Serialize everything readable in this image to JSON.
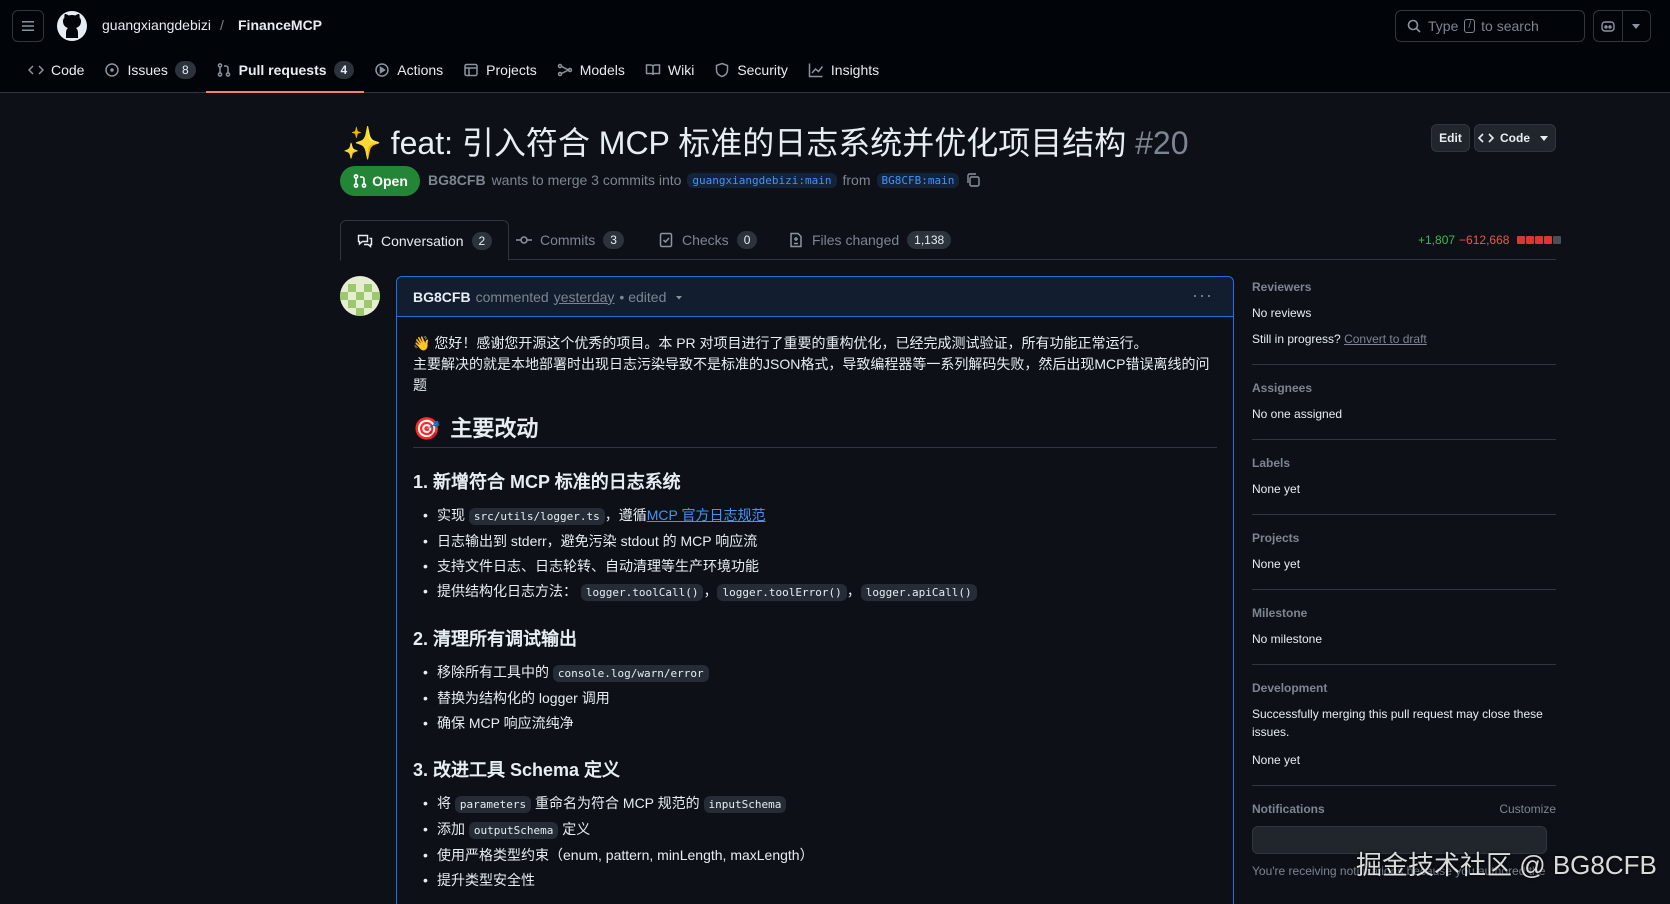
{
  "header": {
    "owner": "guangxiangdebizi",
    "separator": "/",
    "repo": "FinanceMCP",
    "search_prefix": "Type",
    "search_key": "/",
    "search_suffix": "to search"
  },
  "repo_nav": [
    {
      "label": "Code",
      "icon": "code-icon"
    },
    {
      "label": "Issues",
      "count": "8",
      "icon": "issue-icon"
    },
    {
      "label": "Pull requests",
      "count": "4",
      "icon": "pull-request-icon",
      "active": true
    },
    {
      "label": "Actions",
      "icon": "play-icon"
    },
    {
      "label": "Projects",
      "icon": "table-icon"
    },
    {
      "label": "Models",
      "icon": "models-icon"
    },
    {
      "label": "Wiki",
      "icon": "book-icon"
    },
    {
      "label": "Security",
      "icon": "shield-icon"
    },
    {
      "label": "Insights",
      "icon": "graph-icon"
    }
  ],
  "pr": {
    "emoji": "✨",
    "title": "feat: 引入符合 MCP 标准的日志系统并优化项目结构",
    "number": "#20",
    "edit_label": "Edit",
    "code_label": "Code",
    "state": "Open",
    "author": "BG8CFB",
    "merge_text": "wants to merge 3 commits into",
    "base_branch": "guangxiangdebizi:main",
    "from_text": "from",
    "head_branch": "BG8CFB:main"
  },
  "tabs": [
    {
      "label": "Conversation",
      "count": "2",
      "active": true
    },
    {
      "label": "Commits",
      "count": "3"
    },
    {
      "label": "Checks",
      "count": "0"
    },
    {
      "label": "Files changed",
      "count": "1,138"
    }
  ],
  "diffstat": {
    "additions": "+1,807",
    "deletions": "−612,668"
  },
  "comment": {
    "author": "BG8CFB",
    "action": "commented",
    "when": "yesterday",
    "edited": "• edited",
    "intro_line1": "👋 您好！感谢您开源这个优秀的项目。本 PR 对项目进行了重要的重构优化，已经完成测试验证，所有功能正常运行。",
    "intro_line2": "主要解决的就是本地部署时出现日志污染导致不是标准的JSON格式，导致编程器等一系列解码失败，然后出现MCP错误离线的问题",
    "section_emoji": "🎯",
    "section_title": "主要改动",
    "s1_title": "1. 新增符合 MCP 标准的日志系统",
    "s1_item1_pre": "实现",
    "s1_item1_code": "src/utils/logger.ts",
    "s1_item1_mid": "，遵循",
    "s1_item1_link": "MCP 官方日志规范",
    "s1_item2": "日志输出到 stderr，避免污染 stdout 的 MCP 响应流",
    "s1_item3": "支持文件日志、日志轮转、自动清理等生产环境功能",
    "s1_item4_pre": "提供结构化日志方法：",
    "s1_item4_code1": "logger.toolCall()",
    "s1_item4_code2": "logger.toolError()",
    "s1_item4_code3": "logger.apiCall()",
    "sep_comma": "，",
    "s2_title": "2. 清理所有调试输出",
    "s2_item1_pre": "移除所有工具中的",
    "s2_item1_code": "console.log/warn/error",
    "s2_item2": "替换为结构化的 logger 调用",
    "s2_item3": "确保 MCP 响应流纯净",
    "s3_title": "3. 改进工具 Schema 定义",
    "s3_item1_pre": "将",
    "s3_item1_code1": "parameters",
    "s3_item1_mid": "重命名为符合 MCP 规范的",
    "s3_item1_code2": "inputSchema",
    "s3_item2_pre": "添加",
    "s3_item2_code": "outputSchema",
    "s3_item2_post": "定义",
    "s3_item3": "使用严格类型约束（enum, pattern, minLength, maxLength）",
    "s3_item4": "提升类型安全性"
  },
  "sidebar": {
    "reviewers_heading": "Reviewers",
    "reviewers_value": "No reviews",
    "progress_text": "Still in progress?",
    "progress_link": "Convert to draft",
    "assignees_heading": "Assignees",
    "assignees_value": "No one assigned",
    "labels_heading": "Labels",
    "labels_value": "None yet",
    "projects_heading": "Projects",
    "projects_value": "None yet",
    "milestone_heading": "Milestone",
    "milestone_value": "No milestone",
    "development_heading": "Development",
    "development_text": "Successfully merging this pull request may close these issues.",
    "development_value": "None yet",
    "notifications_heading": "Notifications",
    "notifications_customize": "Customize",
    "notifications_note": "You're receiving notifications because you authored the"
  },
  "watermark": "掘金技术社区 @ BG8CFB",
  "colors": {
    "accent_blue": "#1f6feb",
    "open_green": "#238636",
    "tab_underline": "#f78166"
  }
}
